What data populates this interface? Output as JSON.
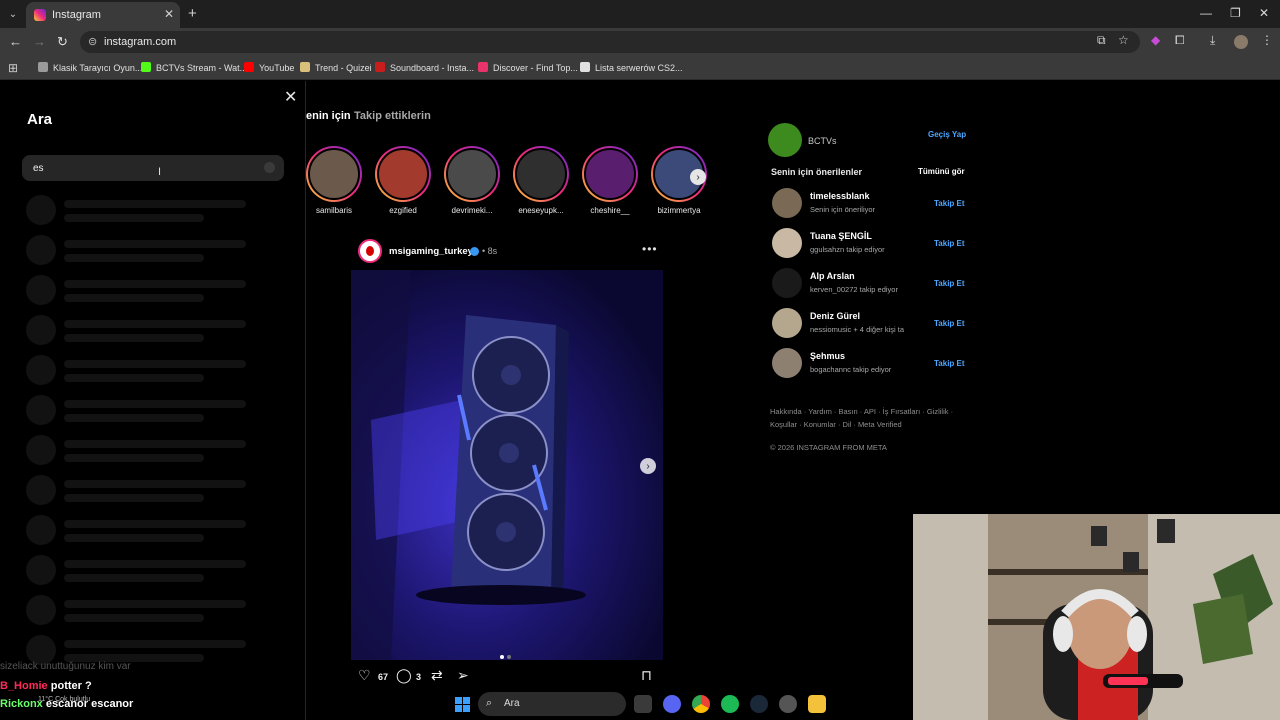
{
  "browser": {
    "tab_title": "Instagram",
    "url": "instagram.com",
    "bookmarks": [
      "Klasik Tarayıcı Oyun...",
      "BCTVs Stream - Wat...",
      "YouTube",
      "Trend - Quizei",
      "Soundboard - Insta...",
      "Discover - Find Top...",
      "Lista serwerów CS2..."
    ],
    "bookmark_colors": [
      "#9a9a9a",
      "#53fc18",
      "#ff0000",
      "#d8c07a",
      "#c81d1d",
      "#e8336b",
      "#e0e0e0"
    ]
  },
  "search": {
    "title": "Ara",
    "value": "es"
  },
  "feed": {
    "tab_for_you": "enin için",
    "tab_following": "Takip ettiklerin",
    "stories": [
      "samilbaris",
      "ezgified",
      "devrimeki...",
      "eneseyupk...",
      "cheshire__",
      "bizimmertya"
    ]
  },
  "post": {
    "username": "msigaming_turkey",
    "time": "• 8s",
    "likes": "67",
    "comments": "3"
  },
  "sidebar": {
    "account_name": "BCTVs",
    "switch_label": "Geçiş Yap",
    "suggestions_header": "Senin için önerilenler",
    "see_all": "Tümünü gör",
    "suggestions": [
      {
        "name": "timelessblank",
        "sub": "Senin için öneriliyor",
        "follow": "Takip Et"
      },
      {
        "name": "Tuana ŞENGİL",
        "sub": "ggulsahzn takip ediyor",
        "follow": "Takip Et"
      },
      {
        "name": "Alp Arslan",
        "sub": "kerven_00272 takip ediyor",
        "follow": "Takip Et"
      },
      {
        "name": "Deniz Gürel",
        "sub": "nessiomusic + 4 diğer kişi ta",
        "follow": "Takip Et"
      },
      {
        "name": "Şehmus",
        "sub": "bogachannc takip ediyor",
        "follow": "Takip Et"
      }
    ],
    "footer_line1": "Hakkında · Yardım · Basın · API · İş Fırsatları · Gizlilik ·",
    "footer_line2": "Koşullar · Konumlar · Dil · Meta Verified",
    "copyright": "© 2026 INSTAGRAM FROM META"
  },
  "chat": {
    "faded": "sizeliack  unuttuğunuz kim var",
    "line1_user": "B_Homie",
    "line1_msg": "potter ?",
    "line2_user": "Rickonx",
    "line2_msg": "escanor escanor"
  },
  "taskbar": {
    "weather_temp": "11°C",
    "weather_desc": "Çok bulutlu",
    "search_placeholder": "Ara"
  }
}
